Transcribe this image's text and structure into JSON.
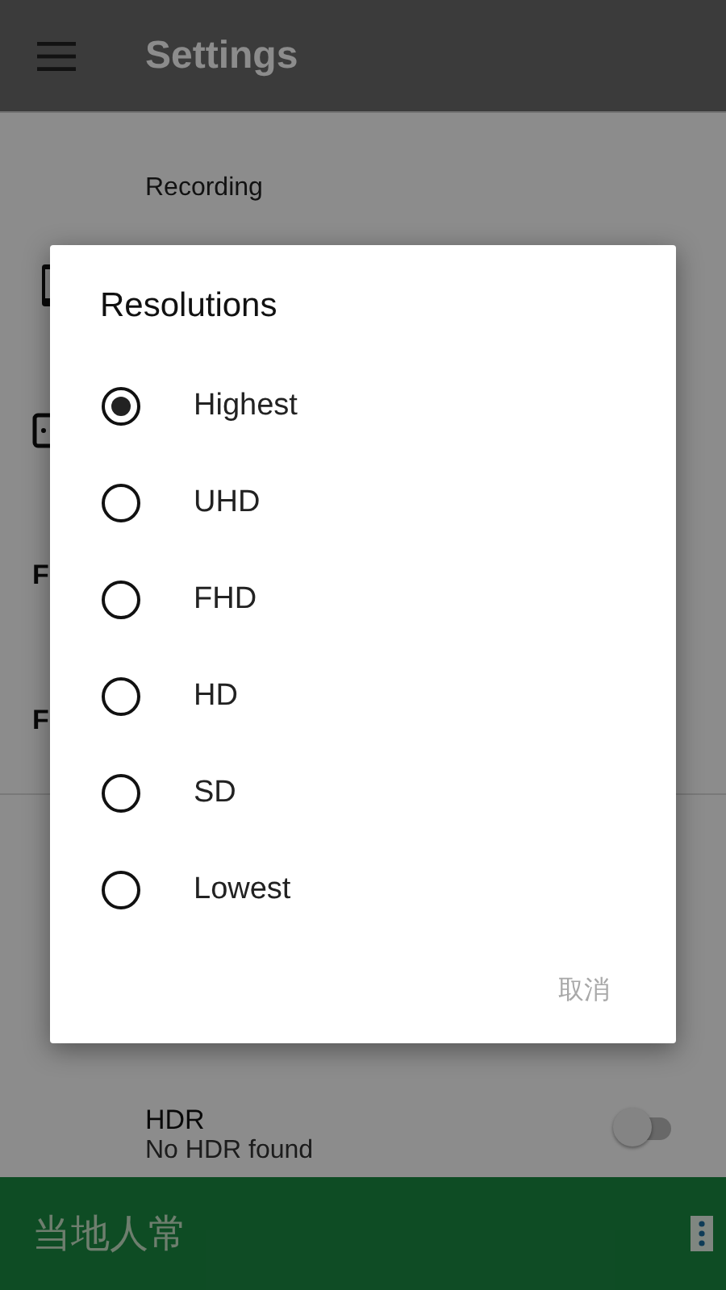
{
  "app_bar": {
    "title": "Settings"
  },
  "category": "Recording",
  "rows": [
    {
      "kind": "device"
    },
    {
      "kind": "frame"
    },
    {
      "kind": "text",
      "title": "F"
    },
    {
      "kind": "text",
      "title": "F"
    }
  ],
  "hdr": {
    "title": "HDR",
    "summary": "No HDR found",
    "on": false
  },
  "ad": {
    "text": "当地人常"
  },
  "dialog": {
    "title": "Resolutions",
    "options": [
      {
        "label": "Highest",
        "selected": true
      },
      {
        "label": "UHD",
        "selected": false
      },
      {
        "label": "FHD",
        "selected": false
      },
      {
        "label": "HD",
        "selected": false
      },
      {
        "label": "SD",
        "selected": false
      },
      {
        "label": "Lowest",
        "selected": false
      }
    ],
    "cancel": "取消"
  }
}
